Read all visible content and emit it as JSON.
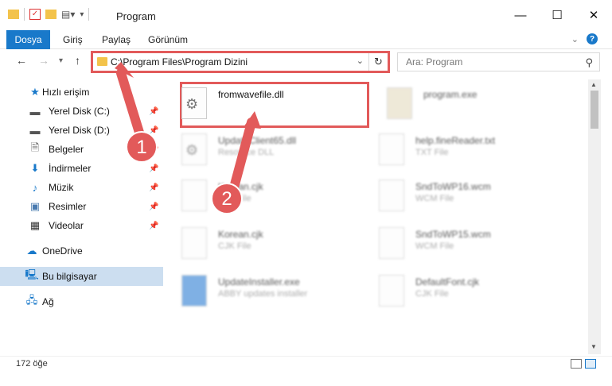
{
  "window": {
    "title": "Program"
  },
  "ribbon": {
    "tabs": [
      "Dosya",
      "Giriş",
      "Paylaş",
      "Görünüm"
    ]
  },
  "address": {
    "path": "C:\\Program Files\\Program Dizini"
  },
  "search": {
    "placeholder": "Ara: Program"
  },
  "sidebar": {
    "items": [
      {
        "label": "Hızlı erişim",
        "icon": "star-icon"
      },
      {
        "label": "Yerel Disk (C:)",
        "icon": "disk-icon",
        "pinned": true
      },
      {
        "label": "Yerel Disk (D:)",
        "icon": "disk-icon",
        "pinned": true
      },
      {
        "label": "Belgeler",
        "icon": "document-icon",
        "pinned": true
      },
      {
        "label": "İndirmeler",
        "icon": "download-icon",
        "pinned": true
      },
      {
        "label": "Müzik",
        "icon": "music-icon",
        "pinned": true
      },
      {
        "label": "Resimler",
        "icon": "picture-icon",
        "pinned": true
      },
      {
        "label": "Videolar",
        "icon": "video-icon",
        "pinned": true
      },
      {
        "label": "OneDrive",
        "icon": "cloud-icon"
      },
      {
        "label": "Bu bilgisayar",
        "icon": "computer-icon",
        "selected": true
      },
      {
        "label": "Ağ",
        "icon": "network-icon"
      }
    ]
  },
  "files": [
    {
      "name": "fromwavefile.dll",
      "type": ""
    },
    {
      "name": "program.exe",
      "type": ""
    },
    {
      "name": "UpdateClient65.dll",
      "type": "Resource DLL"
    },
    {
      "name": "help.fineReader.txt",
      "type": "TXT File"
    },
    {
      "name": "Korean.cjk",
      "type": "CJK File"
    },
    {
      "name": "SndToWP16.wcm",
      "type": "WCM File"
    },
    {
      "name": "Korean.cjk",
      "type": "CJK File"
    },
    {
      "name": "SndToWP15.wcm",
      "type": "WCM File"
    },
    {
      "name": "UpdateInstaller.exe",
      "type": "ABBY updates installer"
    },
    {
      "name": "DefaultFont.cjk",
      "type": "CJK File"
    }
  ],
  "status": {
    "count": "172 öğe"
  },
  "annotations": {
    "marker1": "1",
    "marker2": "2"
  },
  "colors": {
    "accent": "#1979ca",
    "highlight": "#e25a5a"
  }
}
